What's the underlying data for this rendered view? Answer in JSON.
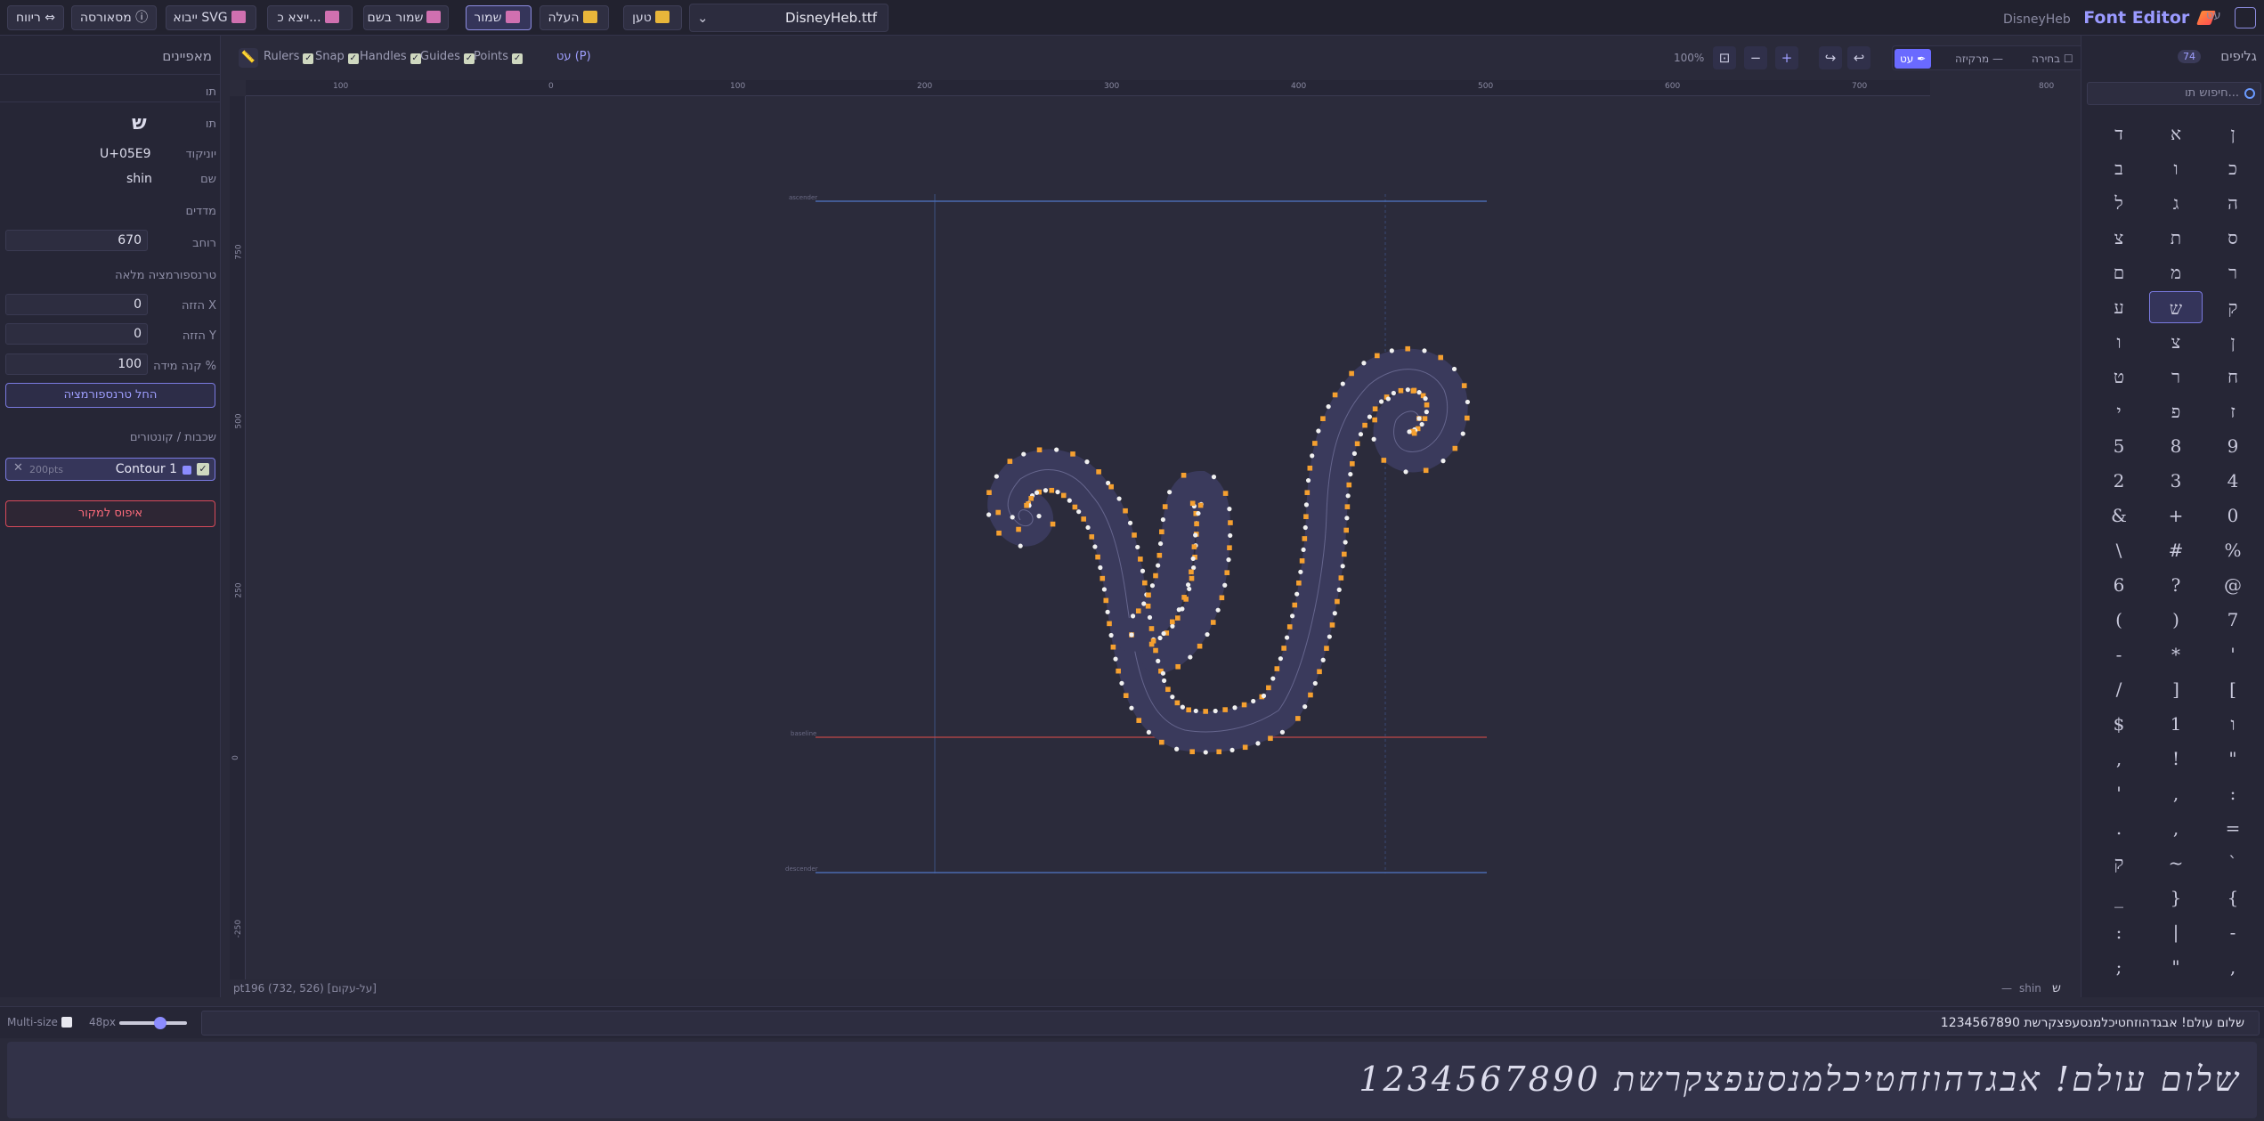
{
  "toolbar": {
    "layout_label": "ריווח",
    "about_label": "מסאורסה",
    "import_svg_label": "ייבוא SVG",
    "export_label": "ייצא כ...",
    "save_as_label": "שמור בשם",
    "save_label": "שמור",
    "upload_label": "העלה",
    "load_label": "טען",
    "file_name": "DisneyHeb.ttf",
    "app_subtitle": "DisneyHeb",
    "app_title": "Font Editor",
    "corner_label": "עט"
  },
  "properties": {
    "title": "מאפיינים",
    "glyph_section": "תו",
    "char_label": "תו",
    "char_value": "ש",
    "unicode_label": "יוניקוד",
    "unicode_value": "U+05E9",
    "name_label": "שם",
    "name_value": "shin",
    "metrics_section": "מדדים",
    "width_label": "רוחב",
    "width_value": "670",
    "transform_section": "טרנספורמציה מלאה",
    "shift_x_label": "הזזה X",
    "shift_x_value": "0",
    "shift_y_label": "הזזה Y",
    "shift_y_value": "0",
    "scale_label": "קנה מידה %",
    "scale_value": "100",
    "apply_label": "החל טרנספורמציה",
    "layers_section": "שכבות / קונטורים",
    "contour_name": "Contour 1",
    "contour_points": "200pts",
    "reset_label": "איפוס למקור"
  },
  "canvas_toolbar": {
    "rulers_label": "Rulers",
    "snap_label": "Snap",
    "handles_label": "Handles",
    "guides_label": "Guides",
    "points_label": "Points",
    "layer_label": "עט (P)",
    "zoom_label": "100%",
    "mode_select": "בחירה",
    "mode_marquee": "מרקיזה",
    "mode_pen": "עט"
  },
  "rulers": {
    "top": [
      "100",
      "0",
      "100",
      "200",
      "300",
      "400",
      "500",
      "600",
      "700",
      "800"
    ],
    "left": [
      "750",
      "500",
      "250",
      "0",
      "-250"
    ]
  },
  "guides": {
    "ascender": "ascender",
    "baseline": "baseline",
    "descender": "descender"
  },
  "status": {
    "point_info": "pt196 (732, 526) [על-עקום]",
    "glyph_name": "shin",
    "glyph_char": "ש",
    "dash": "—"
  },
  "glyph_panel": {
    "title": "גליפים",
    "count": "74",
    "search_placeholder": "חיפוש תו...",
    "columns": [
      [
        "ד",
        "ב",
        "ל",
        "צ",
        "ם",
        "ע",
        "ו",
        "ט",
        "י",
        "5",
        "2",
        "&",
        "\\",
        "6",
        "(",
        "-",
        "/",
        "$",
        ",",
        "'",
        ".",
        "ק",
        "_",
        ":",
        ";"
      ],
      [
        "א",
        "ו",
        "ג",
        "ת",
        "מ",
        "ש",
        "צ",
        "ר",
        "פ",
        "8",
        "3",
        "+",
        "#",
        "?",
        ")",
        "*",
        "]",
        "1",
        "!",
        ",",
        ",",
        "~",
        "}",
        "|",
        "\""
      ],
      [
        "ן",
        "כ",
        "ה",
        "ס",
        "ר",
        "ק",
        "ן",
        "ח",
        "ז",
        "9",
        "4",
        "0",
        "%",
        "@",
        "7",
        "'",
        "[",
        "ו",
        "\"",
        ":",
        "=",
        "`",
        "{",
        "-",
        ","
      ]
    ],
    "selected": "ש"
  },
  "preview": {
    "multisize_label": "Multi-size",
    "size_label": "48px",
    "size_fraction": 0.6,
    "input_text": "שלום עולם! אבגדהוזחטיכלמנסעפצקרשת 1234567890",
    "output_text": "שלום עולם! אבגדהוזחטיכלמנסעפצקרשת 1234567890"
  },
  "colors": {
    "accent": "#8c8cff",
    "on_curve_point": "#f0f0f0",
    "off_curve_point": "#f5a030",
    "glyph_fill": "#3a3a5c",
    "baseline": "#c04848",
    "guide": "#4a6ab0",
    "danger": "#ff6c7c"
  }
}
